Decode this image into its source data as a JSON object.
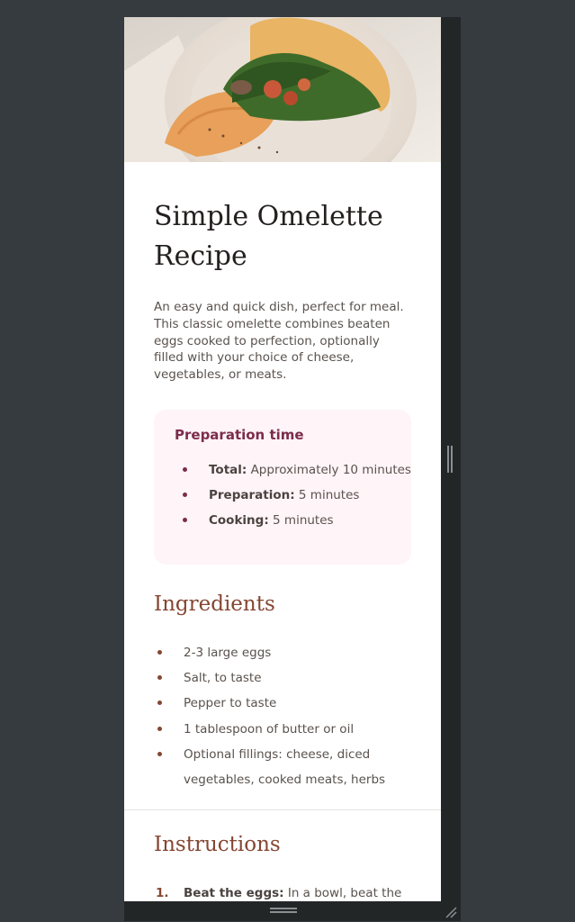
{
  "recipe": {
    "title": "Simple Omelette Recipe",
    "intro": "An easy and quick dish, perfect for meal. This classic omelette combines beaten eggs cooked to perfection, optionally filled with your choice of cheese, vegetables, or meats.",
    "hero_image": "omelette-plate-photo"
  },
  "preparation": {
    "title": "Preparation time",
    "items": [
      {
        "label": "Total:",
        "value": " Approximately 10 minutes"
      },
      {
        "label": "Preparation:",
        "value": " 5 minutes"
      },
      {
        "label": "Cooking:",
        "value": " 5 minutes"
      }
    ]
  },
  "ingredients": {
    "title": "Ingredients",
    "items": [
      "2-3 large eggs",
      "Salt, to taste",
      "Pepper to taste",
      "1 tablespoon of butter or oil",
      "Optional fillings: cheese, diced vegetables, cooked meats, herbs"
    ]
  },
  "instructions": {
    "title": "Instructions",
    "items": [
      {
        "num": "1.",
        "label": "Beat the eggs:",
        "text": " In a bowl, beat the"
      }
    ]
  },
  "colors": {
    "page_bg": "#353b3f",
    "card_bg": "#ffffff",
    "prep_bg": "#fff4f8",
    "prep_accent": "#7b2c4b",
    "heading_accent": "#854632",
    "body_text": "#5a524d"
  }
}
